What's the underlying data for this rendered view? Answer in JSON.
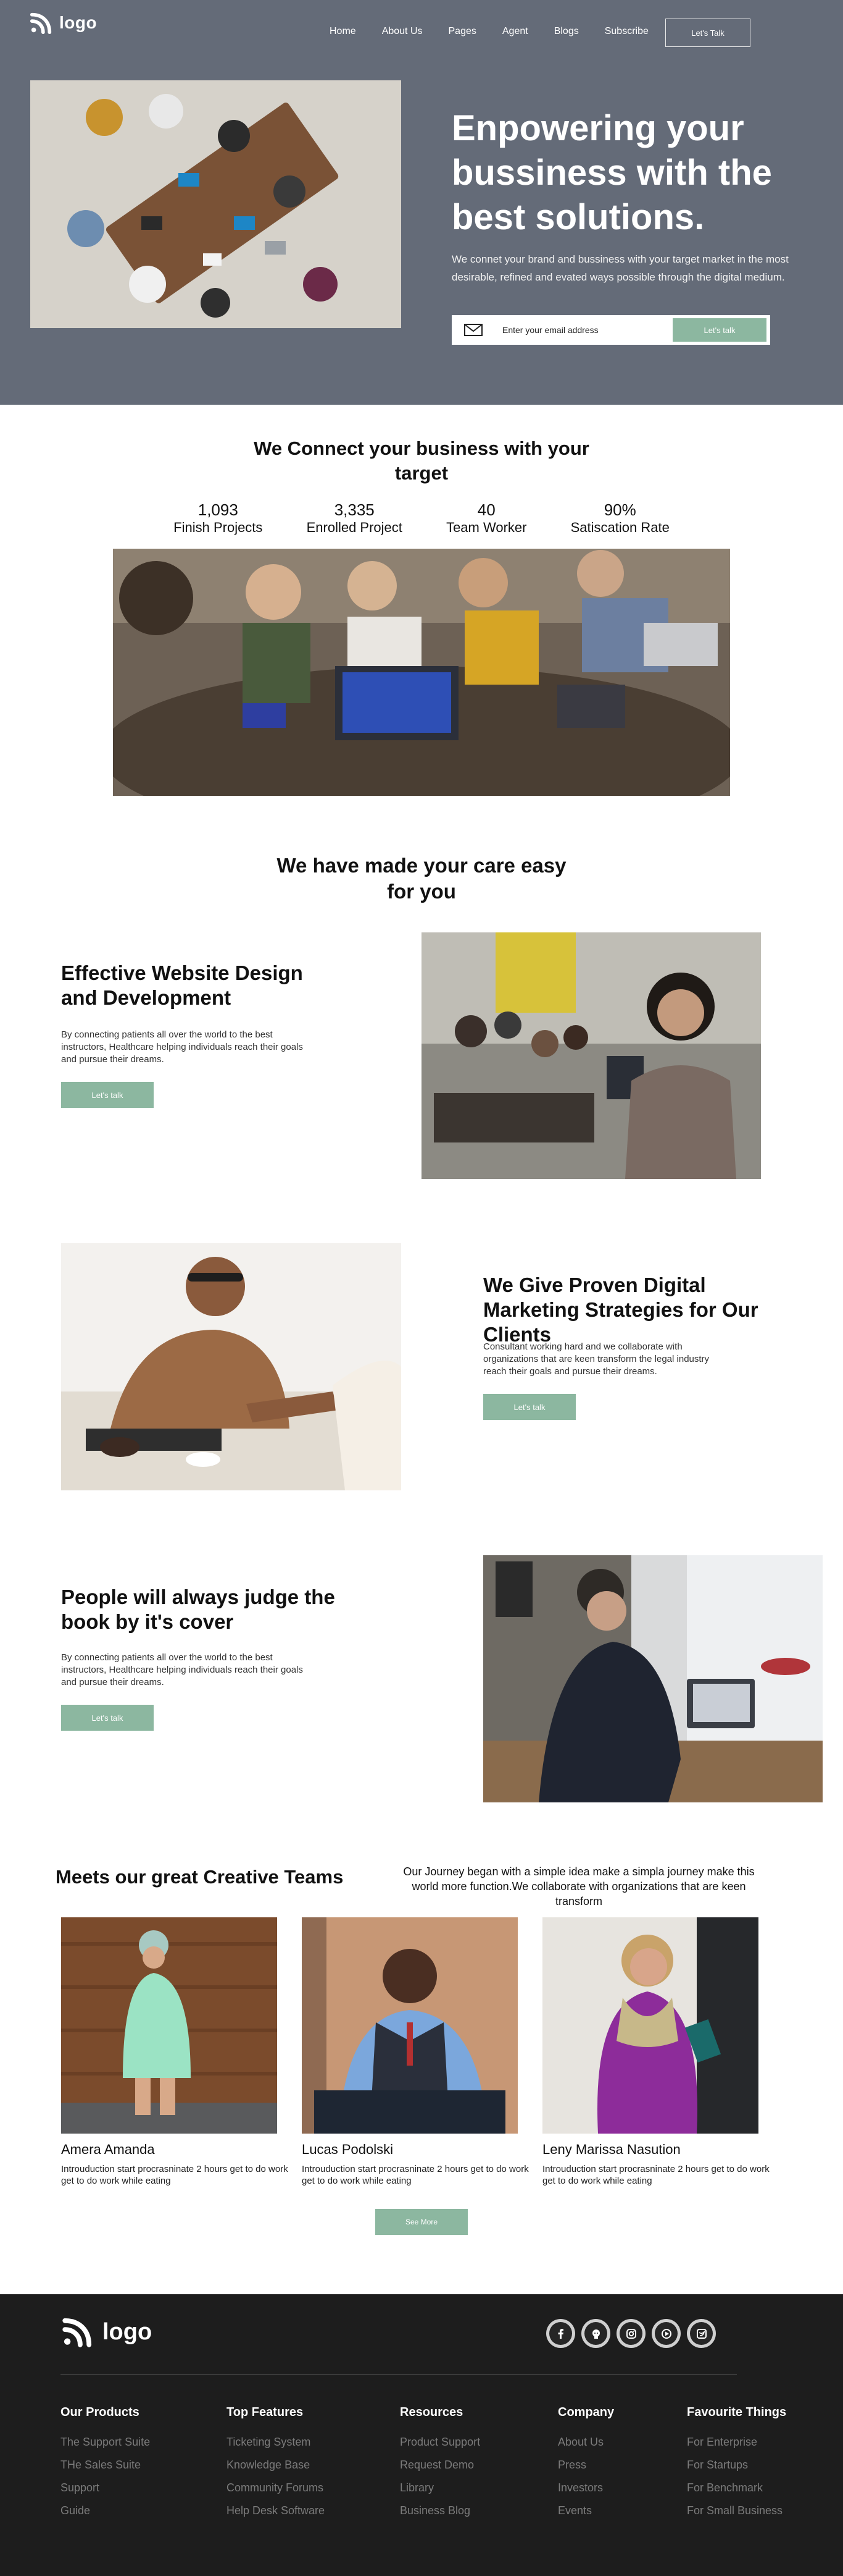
{
  "brand": {
    "logo_text": "logo"
  },
  "nav": {
    "links": [
      "Home",
      "About Us",
      "Pages",
      "Agent",
      "Blogs",
      "Subscribe"
    ],
    "cta": "Let's Talk"
  },
  "hero": {
    "title": "Enpowering your bussiness with the best solutions.",
    "text": "We connet your brand and bussiness with your target market in the most desirable, refined and evated ways possible through the digital medium.",
    "email_placeholder": "Enter your email address",
    "button": "Let's talk"
  },
  "connect": {
    "title": "We Connect your business with your target",
    "stats": [
      {
        "value": "1,093",
        "label": "Finish Projects"
      },
      {
        "value": "3,335",
        "label": "Enrolled Project"
      },
      {
        "value": "40",
        "label": "Team Worker"
      },
      {
        "value": "90%",
        "label": "Satiscation Rate"
      }
    ]
  },
  "care": {
    "title": "We have made your care easy for you"
  },
  "features": [
    {
      "title": "Effective Website Design and Development",
      "text": "By connecting patients all over the world to the best instructors, Healthcare helping individuals reach their goals and pursue their dreams.",
      "button": "Let's talk"
    },
    {
      "title": "We Give Proven Digital Marketing Strategies for Our Clients",
      "text": "Consultant working hard and we collaborate with organizations that are keen transform the legal industry reach their goals and pursue their dreams.",
      "button": "Let's talk"
    },
    {
      "title": "People will always judge the book by it's cover",
      "text": "By connecting patients all over the world to the best instructors, Healthcare helping individuals reach their goals and pursue their dreams.",
      "button": "Let's talk"
    }
  ],
  "teams": {
    "title": "Meets our great Creative Teams",
    "description": "Our Journey began with a simple idea make a simpla journey make this world more function.We collaborate with organizations that are keen transform",
    "members": [
      {
        "name": "Amera Amanda",
        "bio": "Introuduction start procrasninate 2 hours get to do work get to do work while eating"
      },
      {
        "name": "Lucas Podolski",
        "bio": "Introuduction start procrasninate 2 hours get to do work get to do work while eating"
      },
      {
        "name": "Leny Marissa Nasution",
        "bio": "Introuduction start procrasninate 2 hours get to do work get to do work while eating"
      }
    ],
    "see_more": "See More"
  },
  "footer": {
    "logo_text": "logo",
    "socials": [
      "facebook-icon",
      "github-icon",
      "instagram-icon",
      "youtube-icon",
      "twitter-icon"
    ],
    "columns": [
      {
        "heading": "Our Products",
        "links": [
          "The Support Suite",
          "THe Sales Suite",
          "Support",
          "Guide"
        ]
      },
      {
        "heading": "Top Features",
        "links": [
          "Ticketing System",
          "Knowledge Base",
          "Community Forums",
          "Help Desk Software"
        ]
      },
      {
        "heading": "Resources",
        "links": [
          "Product Support",
          "Request Demo",
          "Library",
          "Business Blog"
        ]
      },
      {
        "heading": "Company",
        "links": [
          "About Us",
          "Press",
          "Investors",
          "Events"
        ]
      },
      {
        "heading": "Favourite Things",
        "links": [
          "For Enterprise",
          "For Startups",
          "For Benchmark",
          "For Small Business"
        ]
      }
    ]
  },
  "colors": {
    "hero_bg": "#646b78",
    "accent": "#8cb7a0",
    "footer_bg": "#1d1d1d",
    "footer_link": "#7b7b7b"
  }
}
